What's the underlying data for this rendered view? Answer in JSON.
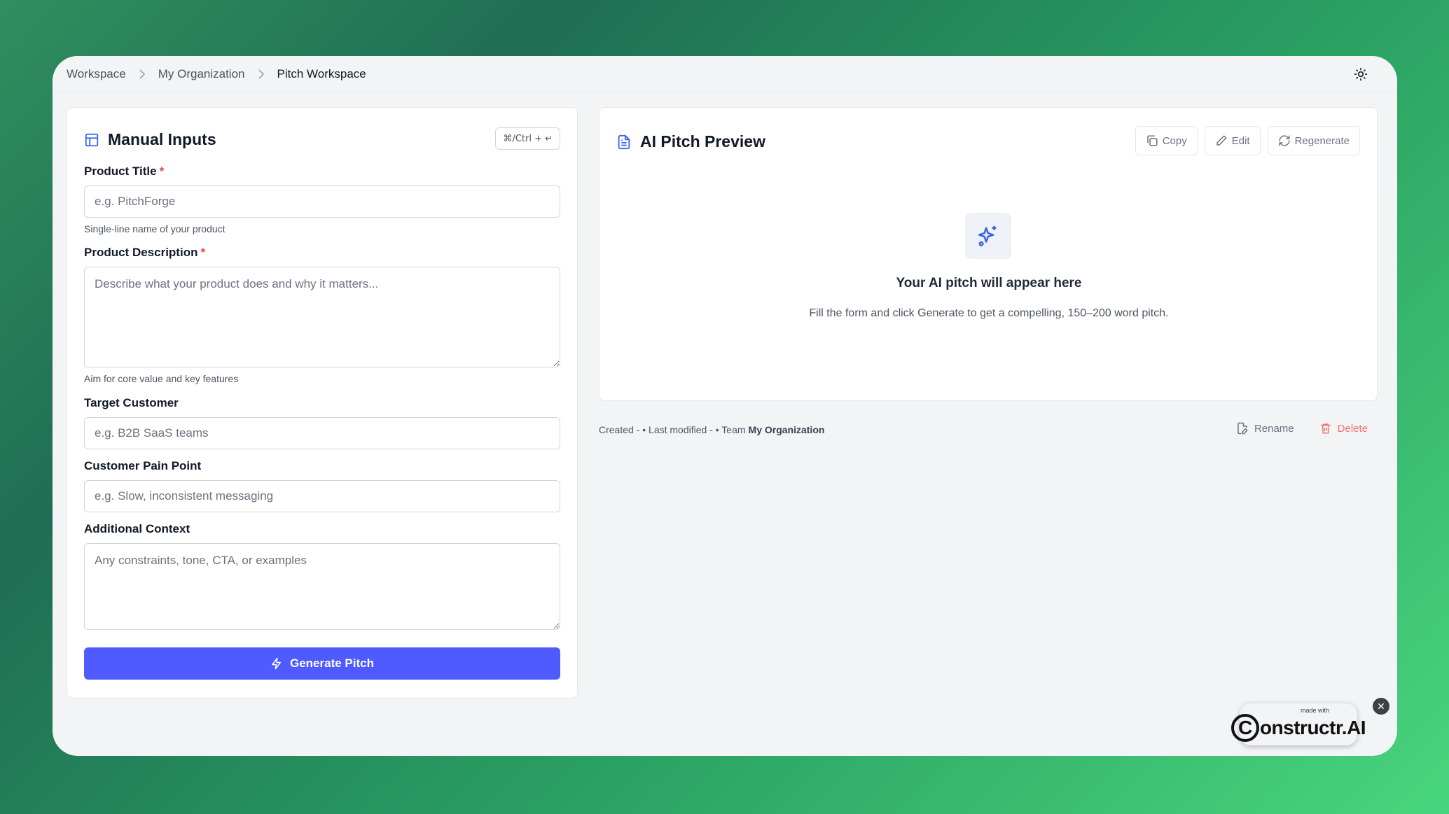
{
  "breadcrumb": {
    "items": [
      "Workspace",
      "My Organization",
      "Pitch Workspace"
    ]
  },
  "manual_inputs": {
    "title": "Manual Inputs",
    "shortcut": "⌘/Ctrl + ↵",
    "fields": {
      "product_title": {
        "label": "Product Title",
        "required_mark": "*",
        "placeholder": "e.g. PitchForge",
        "hint": "Single-line name of your product"
      },
      "product_description": {
        "label": "Product Description",
        "required_mark": "*",
        "placeholder": "Describe what your product does and why it matters...",
        "hint": "Aim for core value and key features"
      },
      "target_customer": {
        "label": "Target Customer",
        "placeholder": "e.g. B2B SaaS teams"
      },
      "pain_point": {
        "label": "Customer Pain Point",
        "placeholder": "e.g. Slow, inconsistent messaging"
      },
      "additional_context": {
        "label": "Additional Context",
        "placeholder": "Any constraints, tone, CTA, or examples"
      }
    },
    "generate_label": "Generate Pitch"
  },
  "preview": {
    "title": "AI Pitch Preview",
    "actions": {
      "copy": "Copy",
      "edit": "Edit",
      "regenerate": "Regenerate"
    },
    "empty_title": "Your AI pitch will appear here",
    "empty_subtitle": "Fill the form and click Generate to get a compelling, 150–200 word pitch."
  },
  "meta": {
    "text": "Created - • Last modified - • Team",
    "org": "My Organization",
    "rename": "Rename",
    "delete": "Delete"
  },
  "badge": {
    "made_with": "made with",
    "brand_letter": "C",
    "brand_rest": "onstructr.AI"
  },
  "colors": {
    "accent": "#4f5bff",
    "icon_blue": "#3b63e6",
    "danger": "#f87171"
  }
}
